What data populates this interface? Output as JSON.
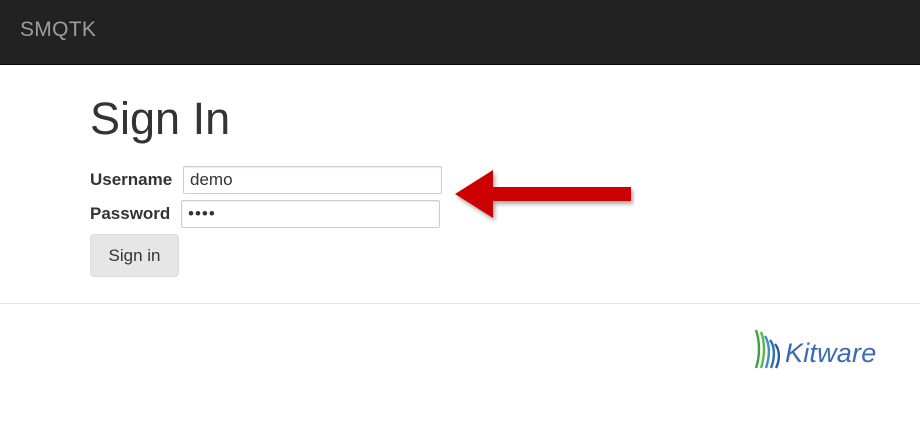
{
  "navbar": {
    "brand": "SMQTK"
  },
  "page": {
    "title": "Sign In"
  },
  "form": {
    "username": {
      "label": "Username",
      "value": "demo"
    },
    "password": {
      "label": "Password",
      "value": "demo"
    },
    "submit_label": "Sign in"
  },
  "footer": {
    "logo_text": "Kitware"
  },
  "colors": {
    "navbar_bg": "#222222",
    "brand_text": "#9d9d9d",
    "arrow": "#cc0000",
    "logo_text": "#3b6bb3",
    "logo_green": "#3aa23a"
  }
}
